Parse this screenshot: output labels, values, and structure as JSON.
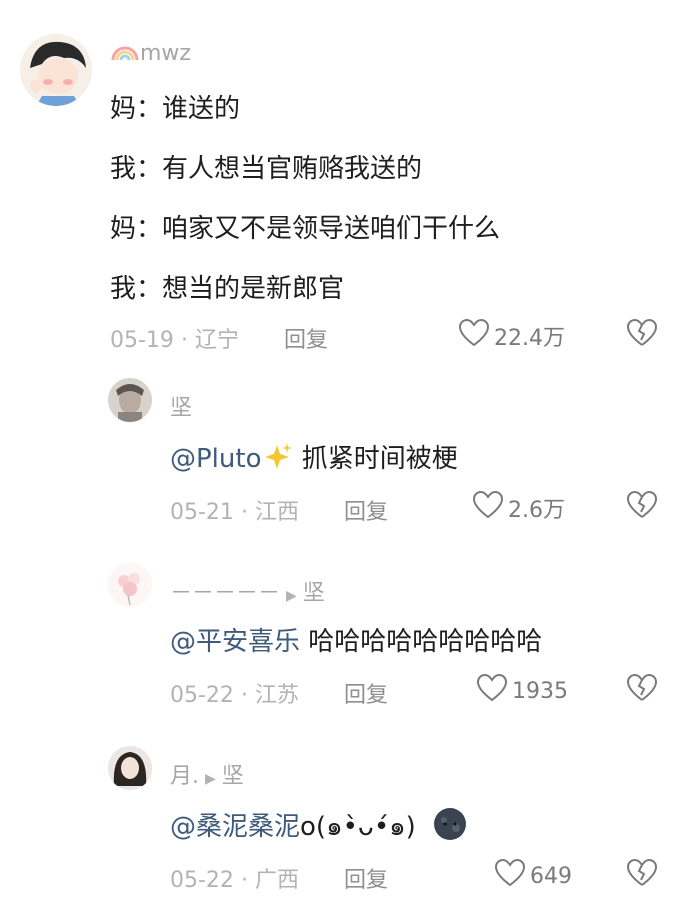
{
  "comments": [
    {
      "username": "mwz",
      "lines": [
        "妈：谁送的",
        "我：有人想当官贿赂我送的",
        "妈：咱家又不是领导送咱们干什么",
        "我：想当的是新郎官"
      ],
      "date": "05-19",
      "location": "辽宁",
      "reply_label": "回复",
      "likes": "22.4万"
    },
    {
      "username": "坚",
      "mention": "@Pluto",
      "text": "抓紧时间被梗",
      "date": "05-21",
      "location": "江西",
      "reply_label": "回复",
      "likes": "2.6万"
    },
    {
      "username": "－－－－－",
      "reply_to": "坚",
      "mention": "@平安喜乐",
      "text": "哈哈哈哈哈哈哈哈哈",
      "date": "05-22",
      "location": "江苏",
      "reply_label": "回复",
      "likes": "1935"
    },
    {
      "username": "月.",
      "reply_to": "坚",
      "mention": "@桑泥桑泥",
      "text": "o(๑•̀ᴗ•́๑)",
      "date": "05-22",
      "location": "广西",
      "reply_label": "回复",
      "likes": "649"
    }
  ],
  "colors": {
    "text": "#1e1e1e",
    "meta": "#b3b3b3",
    "mention": "#3e5a7c",
    "icon": "#7a7a7a"
  }
}
